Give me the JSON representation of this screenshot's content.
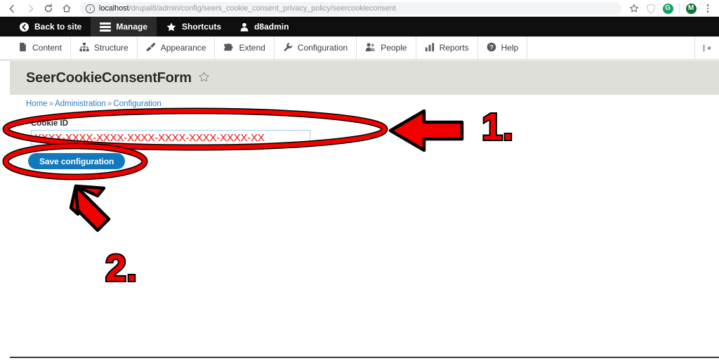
{
  "browser": {
    "back_icon": "back-arrow-icon",
    "forward_icon": "forward-arrow-icon",
    "reload_icon": "reload-icon",
    "home_icon": "home-icon",
    "site_info_icon": "info-circle-icon",
    "url_host": "localhost",
    "url_path": "/drupal8/admin/config/seers_cookie_consent_privacy_policy/seercookieconsent",
    "bookmark_icon": "star-outline-icon",
    "shield_icon": "shield-icon",
    "extension_badge": "G",
    "profile_badge": "M",
    "menu_icon": "kebab-menu-icon"
  },
  "admin_toolbar": {
    "items": [
      {
        "label": "Back to site",
        "icon": "back-circle-icon",
        "active": false
      },
      {
        "label": "Manage",
        "icon": "hamburger-icon",
        "active": true
      },
      {
        "label": "Shortcuts",
        "icon": "star-icon",
        "active": false
      },
      {
        "label": "d8admin",
        "icon": "user-icon",
        "active": false
      }
    ]
  },
  "admin_menu": {
    "items": [
      {
        "label": "Content",
        "icon": "document-icon"
      },
      {
        "label": "Structure",
        "icon": "sitemap-icon"
      },
      {
        "label": "Appearance",
        "icon": "paintbrush-icon"
      },
      {
        "label": "Extend",
        "icon": "puzzle-piece-icon"
      },
      {
        "label": "Configuration",
        "icon": "wrench-icon"
      },
      {
        "label": "People",
        "icon": "people-icon"
      },
      {
        "label": "Reports",
        "icon": "bar-chart-icon"
      },
      {
        "label": "Help",
        "icon": "question-circle-icon"
      }
    ],
    "collapse_icon": "collapse-toolbar-icon"
  },
  "page": {
    "title": "SeerCookieConsentForm",
    "title_star_icon": "star-outline-icon",
    "breadcrumb": [
      {
        "label": "Home",
        "link": true
      },
      {
        "label": "Administration",
        "link": true
      },
      {
        "label": "Configuration",
        "link": true
      }
    ],
    "breadcrumb_separator": "»"
  },
  "form": {
    "cookie_id": {
      "label": "Cookie ID",
      "value": "XXXX-XXXX-XXXX-XXXX-XXXX-XXXX-XXXX-XX",
      "placeholder": "",
      "value_color": "#ee1111"
    },
    "save_button": {
      "label": "Save configuration",
      "color": "#1279bf"
    }
  },
  "annotations": {
    "color": "#f20000",
    "outline_color": "#000000",
    "items": [
      {
        "name": "step-1-callout",
        "label": "1.",
        "target": "cookie-id-input",
        "shape": "ellipse-and-left-arrow"
      },
      {
        "name": "step-2-callout",
        "label": "2.",
        "target": "save-configuration-button",
        "shape": "ellipse-and-diagonal-arrow"
      }
    ]
  }
}
